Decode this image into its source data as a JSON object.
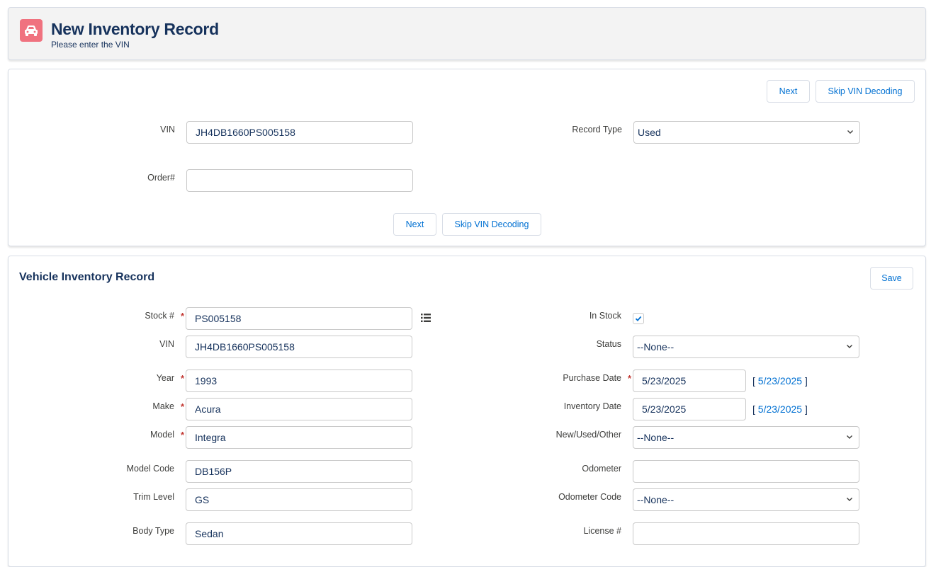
{
  "header": {
    "title": "New Inventory Record",
    "subtitle": "Please enter the VIN",
    "icon": "car-icon",
    "icon_color": "#f0727f"
  },
  "vin_section": {
    "next_label": "Next",
    "skip_label": "Skip VIN Decoding",
    "vin_label": "VIN",
    "vin_value": "JH4DB1660PS005158",
    "order_label": "Order#",
    "order_value": "",
    "record_type_label": "Record Type",
    "record_type_value": "Used"
  },
  "record": {
    "title": "Vehicle Inventory Record",
    "save_label": "Save",
    "left_fields": {
      "stock": {
        "label": "Stock #",
        "value": "PS005158"
      },
      "vin": {
        "label": "VIN",
        "value": "JH4DB1660PS005158"
      },
      "year": {
        "label": "Year",
        "value": "1993"
      },
      "make": {
        "label": "Make",
        "value": "Acura"
      },
      "model": {
        "label": "Model",
        "value": "Integra"
      },
      "model_code": {
        "label": "Model Code",
        "value": "DB156P"
      },
      "trim_level": {
        "label": "Trim Level",
        "value": "GS"
      },
      "body_type": {
        "label": "Body Type",
        "value": "Sedan"
      }
    },
    "right_fields": {
      "in_stock": {
        "label": "In Stock",
        "checked": true
      },
      "status": {
        "label": "Status",
        "value": "--None--"
      },
      "purchase_date": {
        "label": "Purchase Date",
        "value": "5/23/2025",
        "today_link": "5/23/2025"
      },
      "inventory_date": {
        "label": "Inventory Date",
        "value": "5/23/2025",
        "today_link": "5/23/2025"
      },
      "new_used_other": {
        "label": "New/Used/Other",
        "value": "--None--"
      },
      "odometer": {
        "label": "Odometer",
        "value": ""
      },
      "odometer_code": {
        "label": "Odometer Code",
        "value": "--None--"
      },
      "license": {
        "label": "License #",
        "value": ""
      }
    }
  },
  "colors": {
    "link": "#0070d2",
    "title": "#16325c",
    "required": "#c23934"
  }
}
